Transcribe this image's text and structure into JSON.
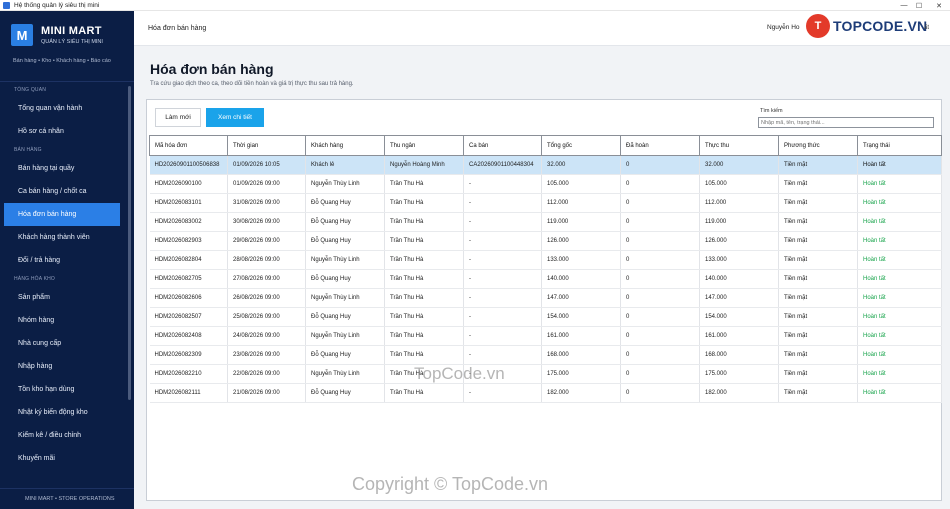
{
  "window": {
    "title": "Hệ thống quản lý siêu thị mini",
    "controls": [
      "—",
      "☐",
      "✕"
    ]
  },
  "sidebar": {
    "brand_initial": "M",
    "brand_name": "MINI MART",
    "brand_sub": "QUẢN LÝ SIÊU THỊ MINI",
    "brand_nav": "Bán hàng • Kho • Khách hàng • Báo cáo",
    "sections": [
      {
        "title": "TỔNG QUAN",
        "items": [
          "Tổng quan vận hành",
          "Hồ sơ cá nhân"
        ]
      },
      {
        "title": "BÁN HÀNG",
        "items": [
          "Bán hàng tại quầy",
          "Ca bán hàng / chốt ca",
          "Hóa đơn bán hàng",
          "Khách hàng thành viên",
          "Đổi / trả hàng"
        ]
      },
      {
        "title": "HÀNG HÓA  KHO",
        "items": [
          "Sản phẩm",
          "Nhóm hàng",
          "Nhà cung cấp",
          "Nhập hàng",
          "Tồn kho  hạn dùng",
          "Nhật ký biến động kho",
          "Kiểm kê / điều chỉnh",
          "Khuyến mãi"
        ]
      }
    ],
    "active": "Hóa đơn bán hàng",
    "footer": "MINI MART • STORE OPERATIONS"
  },
  "header": {
    "crumb": "Hóa đơn bán hàng",
    "user": "Nguyễn Ho",
    "logo_badge": "T",
    "logo_text": "TOPCODE.VN",
    "tail": "ất"
  },
  "page": {
    "title": "Hóa đơn bán hàng",
    "subtitle": "Tra cứu giao dịch theo ca, theo dõi tiền hoàn và giá trị thực thu sau trả hàng."
  },
  "toolbar": {
    "refresh_label": "Làm mới",
    "detail_label": "Xem chi tiết",
    "search_label": "Tìm kiếm",
    "search_placeholder": "Nhập mã, tên, trạng thái..."
  },
  "table": {
    "columns": [
      "Mã hóa đơn",
      "Thời gian",
      "Khách hàng",
      "Thu ngân",
      "Ca bán",
      "Tổng gốc",
      "Đã hoàn",
      "Thực thu",
      "Phương thức",
      "Trạng thái"
    ],
    "rows": [
      [
        "HD20260901100506838",
        "01/09/2026 10:05",
        "Khách lẻ",
        "Nguyễn Hoàng Minh",
        "CA20260901100448304",
        "32.000",
        "0",
        "32.000",
        "Tiền mặt",
        "Hoàn tất"
      ],
      [
        "HDM2026090100",
        "01/09/2026 09:00",
        "Nguyễn Thùy Linh",
        "Trần Thu Hà",
        "-",
        "105.000",
        "0",
        "105.000",
        "Tiền mặt",
        "Hoàn tất"
      ],
      [
        "HDM2026083101",
        "31/08/2026 09:00",
        "Đỗ Quang Huy",
        "Trần Thu Hà",
        "-",
        "112.000",
        "0",
        "112.000",
        "Tiền mặt",
        "Hoàn tất"
      ],
      [
        "HDM2026083002",
        "30/08/2026 09:00",
        "Đỗ Quang Huy",
        "Trần Thu Hà",
        "-",
        "119.000",
        "0",
        "119.000",
        "Tiền mặt",
        "Hoàn tất"
      ],
      [
        "HDM2026082903",
        "29/08/2026 09:00",
        "Đỗ Quang Huy",
        "Trần Thu Hà",
        "-",
        "126.000",
        "0",
        "126.000",
        "Tiền mặt",
        "Hoàn tất"
      ],
      [
        "HDM2026082804",
        "28/08/2026 09:00",
        "Nguyễn Thùy Linh",
        "Trần Thu Hà",
        "-",
        "133.000",
        "0",
        "133.000",
        "Tiền mặt",
        "Hoàn tất"
      ],
      [
        "HDM2026082705",
        "27/08/2026 09:00",
        "Đỗ Quang Huy",
        "Trần Thu Hà",
        "-",
        "140.000",
        "0",
        "140.000",
        "Tiền mặt",
        "Hoàn tất"
      ],
      [
        "HDM2026082606",
        "26/08/2026 09:00",
        "Nguyễn Thùy Linh",
        "Trần Thu Hà",
        "-",
        "147.000",
        "0",
        "147.000",
        "Tiền mặt",
        "Hoàn tất"
      ],
      [
        "HDM2026082507",
        "25/08/2026 09:00",
        "Đỗ Quang Huy",
        "Trần Thu Hà",
        "-",
        "154.000",
        "0",
        "154.000",
        "Tiền mặt",
        "Hoàn tất"
      ],
      [
        "HDM2026082408",
        "24/08/2026 09:00",
        "Nguyễn Thùy Linh",
        "Trần Thu Hà",
        "-",
        "161.000",
        "0",
        "161.000",
        "Tiền mặt",
        "Hoàn tất"
      ],
      [
        "HDM2026082309",
        "23/08/2026 09:00",
        "Đỗ Quang Huy",
        "Trần Thu Hà",
        "-",
        "168.000",
        "0",
        "168.000",
        "Tiền mặt",
        "Hoàn tất"
      ],
      [
        "HDM2026082210",
        "22/08/2026 09:00",
        "Nguyễn Thùy Linh",
        "Trần Thu Hà",
        "-",
        "175.000",
        "0",
        "175.000",
        "Tiền mặt",
        "Hoàn tất"
      ],
      [
        "HDM2026082111",
        "21/08/2026 09:00",
        "Đỗ Quang Huy",
        "Trần Thu Hà",
        "-",
        "182.000",
        "0",
        "182.000",
        "Tiền mặt",
        "Hoàn tất"
      ]
    ],
    "selected_row": 0
  },
  "watermarks": {
    "center": "TopCode.vn",
    "bottom": "Copyright © TopCode.vn"
  },
  "colors": {
    "sidebar": "#0b1e45",
    "accent": "#2b7fe6",
    "primary_button": "#1aa3ea",
    "status_ok": "#16a34a",
    "selected_row": "#cce4f7"
  }
}
